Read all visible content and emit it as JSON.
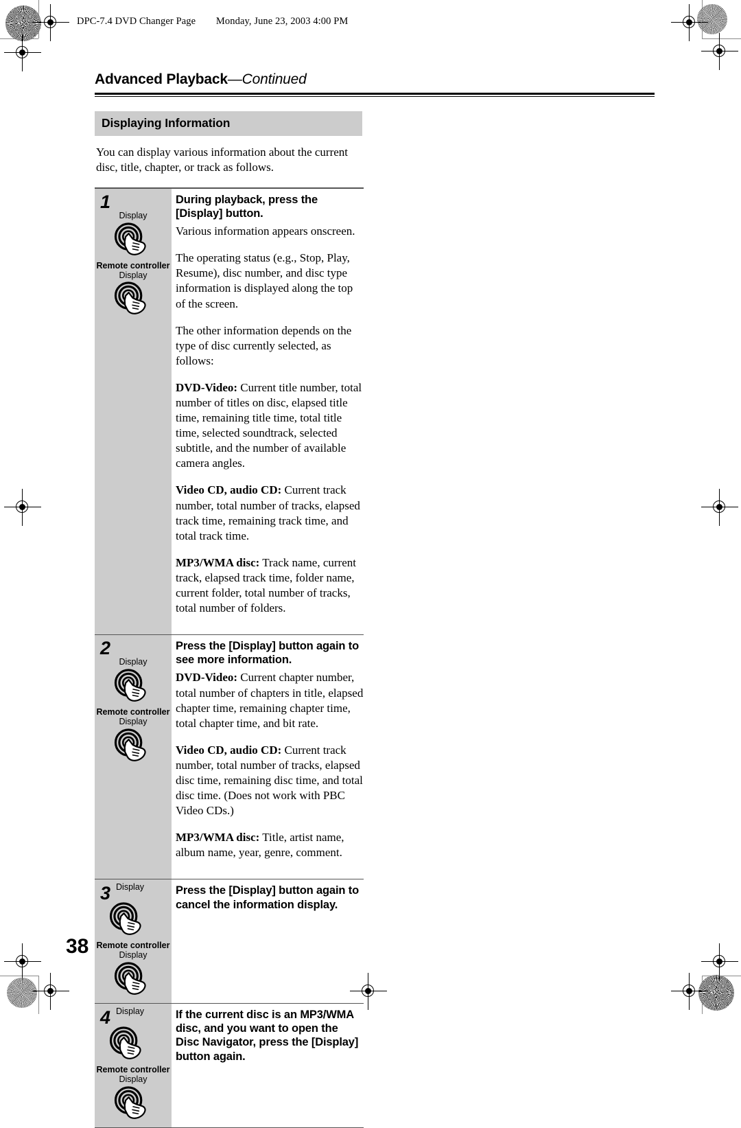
{
  "running_head": {
    "document_name": "DPC-7.4 DVD Changer  Page",
    "timestamp": "Monday, June 23, 2003  4:00 PM"
  },
  "chapter": {
    "title": "Advanced Playback",
    "continued": "—Continued"
  },
  "section": {
    "heading": "Displaying Information",
    "intro": "You can display various information about the current disc, title, chapter, or track as follows."
  },
  "labels": {
    "display_button": "Display",
    "remote_controller": "Remote controller"
  },
  "steps": [
    {
      "number": "1",
      "heading": "During playback, press the [Display] button.",
      "layout": "stacked",
      "paragraphs": [
        {
          "lead": "",
          "text": "Various information appears onscreen."
        },
        {
          "lead": "",
          "text": "The operating status (e.g., Stop, Play, Resume), disc number, and disc type information is displayed along the top of the screen."
        },
        {
          "lead": "",
          "text": "The other information depends on the type of disc currently selected, as follows:"
        },
        {
          "lead": "DVD-Video:",
          "text": "Current title number, total number of titles on disc, elapsed title time, remaining title time, total title time, selected soundtrack, selected subtitle, and the number of available camera angles."
        },
        {
          "lead": "Video CD, audio CD:",
          "text": "Current track number, total number of tracks, elapsed track time, remaining track time, and total track time."
        },
        {
          "lead": "MP3/WMA disc:",
          "text": "Track name, current track, elapsed track time, folder name, current folder, total number of tracks, total number of folders."
        }
      ]
    },
    {
      "number": "2",
      "heading": "Press the [Display] button again to see more information.",
      "layout": "stacked",
      "paragraphs": [
        {
          "lead": "DVD-Video:",
          "text": "Current chapter number, total number of chapters in title, elapsed chapter time, remaining chapter time, total chapter time, and bit rate."
        },
        {
          "lead": "Video CD, audio CD:",
          "text": "Current track number, total number of tracks, elapsed disc time, remaining disc time, and total disc time. (Does not work with PBC Video CDs.)"
        },
        {
          "lead": "MP3/WMA disc:",
          "text": "Title, artist name, album name, year, genre, comment."
        }
      ]
    },
    {
      "number": "3",
      "heading": "Press the [Display] button again to cancel the information display.",
      "layout": "inline",
      "paragraphs": []
    },
    {
      "number": "4",
      "heading": "If the current disc is an MP3/WMA disc, and you want to open the Disc Navigator, press the [Display] button again.",
      "layout": "inline",
      "paragraphs": []
    }
  ],
  "page_number": "38",
  "colors": {
    "panel_gray": "#cccccc",
    "rule": "#555555",
    "text": "#000000"
  }
}
